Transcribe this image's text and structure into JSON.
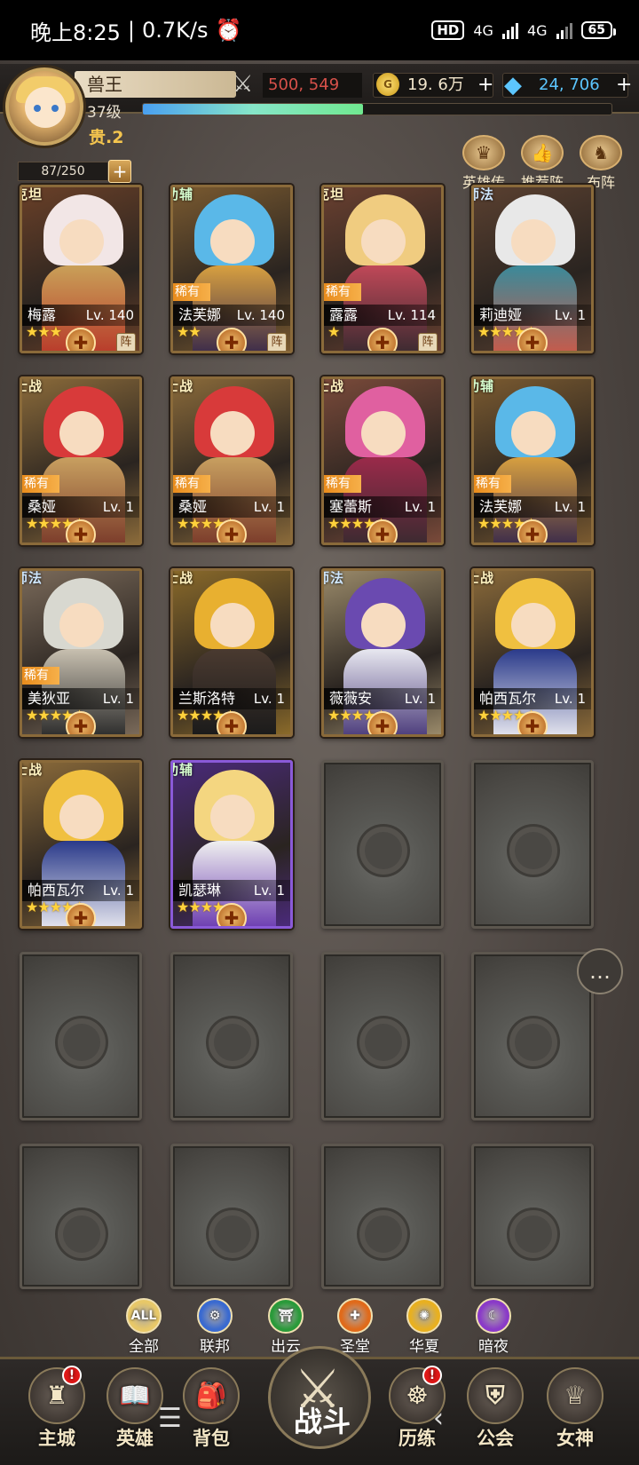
{
  "status_bar": {
    "time": "晚上8:25",
    "speed": "0.7K/s",
    "hd": "HD",
    "net1": "4G",
    "net2": "4G",
    "battery": "65"
  },
  "player": {
    "name": "兽王",
    "power": "500, 549",
    "gold": "19. 6万",
    "gold_icon": "G",
    "gems": "24, 706",
    "level": "37级",
    "exp_fraction": 0.47,
    "noble": "贵.2",
    "hero_slots": "87/250"
  },
  "top_buttons": [
    "英雄传",
    "推荐阵",
    "布阵"
  ],
  "heroes": [
    {
      "name": "梅露",
      "lv": "Lv. 140",
      "role": "坦克",
      "rare": "",
      "stars": 3,
      "team": "阵",
      "palette": "tank-white"
    },
    {
      "name": "法芙娜",
      "lv": "Lv. 140",
      "role": "辅助",
      "rare": "稀有",
      "stars": 2,
      "team": "阵",
      "palette": "blue-gold"
    },
    {
      "name": "露露",
      "lv": "Lv. 114",
      "role": "坦克",
      "rare": "稀有",
      "stars": 1,
      "team": "阵",
      "palette": "blonde-red"
    },
    {
      "name": "莉迪娅",
      "lv": "Lv. 1",
      "role": "法师",
      "rare": "",
      "stars": 5,
      "team": "",
      "palette": "white-teal"
    },
    {
      "name": "桑娅",
      "lv": "Lv. 1",
      "role": "战士",
      "rare": "稀有",
      "stars": 5,
      "team": "",
      "palette": "red-gold"
    },
    {
      "name": "桑娅",
      "lv": "Lv. 1",
      "role": "战士",
      "rare": "稀有",
      "stars": 5,
      "team": "",
      "palette": "red-gold"
    },
    {
      "name": "塞蕾斯",
      "lv": "Lv. 1",
      "role": "战士",
      "rare": "稀有",
      "stars": 5,
      "team": "",
      "palette": "pink"
    },
    {
      "name": "法芙娜",
      "lv": "Lv. 1",
      "role": "辅助",
      "rare": "稀有",
      "stars": 5,
      "team": "",
      "palette": "blue-gold"
    },
    {
      "name": "美狄亚",
      "lv": "Lv. 1",
      "role": "法师",
      "rare": "稀有",
      "stars": 5,
      "team": "",
      "palette": "silver"
    },
    {
      "name": "兰斯洛特",
      "lv": "Lv. 1",
      "role": "战士",
      "rare": "",
      "stars": 5,
      "team": "",
      "palette": "gold-armor"
    },
    {
      "name": "薇薇安",
      "lv": "Lv. 1",
      "role": "法师",
      "rare": "",
      "stars": 5,
      "team": "",
      "palette": "purple"
    },
    {
      "name": "帕西瓦尔",
      "lv": "Lv. 1",
      "role": "战士",
      "rare": "",
      "stars": 5,
      "team": "",
      "palette": "blonde-blue"
    },
    {
      "name": "帕西瓦尔",
      "lv": "Lv. 1",
      "role": "战士",
      "rare": "",
      "stars": 5,
      "team": "",
      "palette": "blonde-blue"
    },
    {
      "name": "凯瑟琳",
      "lv": "Lv. 1",
      "role": "辅助",
      "rare": "",
      "stars": 4,
      "team": "",
      "palette": "blonde-white"
    }
  ],
  "filters": [
    {
      "label": "全部",
      "icon": "ALL",
      "color": "#e8c868"
    },
    {
      "label": "联邦",
      "icon": "gear",
      "color": "#3a6ad0"
    },
    {
      "label": "出云",
      "icon": "torii",
      "color": "#2a9a3a"
    },
    {
      "label": "圣堂",
      "icon": "cross",
      "color": "#e06a1a"
    },
    {
      "label": "华夏",
      "icon": "flame",
      "color": "#e8b020"
    },
    {
      "label": "暗夜",
      "icon": "moon",
      "color": "#8a3ac8"
    }
  ],
  "bottom_nav": [
    {
      "label": "主城",
      "icon": "castle",
      "badge": "!"
    },
    {
      "label": "英雄",
      "icon": "book",
      "badge": ""
    },
    {
      "label": "背包",
      "icon": "bag",
      "badge": ""
    },
    {
      "label": "历练",
      "icon": "wheel",
      "badge": "!"
    },
    {
      "label": "公会",
      "icon": "shield",
      "badge": ""
    },
    {
      "label": "女神",
      "icon": "angel",
      "badge": ""
    }
  ],
  "battle_label": "战斗",
  "colors": {
    "power_text": "#d7514a",
    "gem": "#5cc6ff",
    "gold": "#f4c54e"
  }
}
